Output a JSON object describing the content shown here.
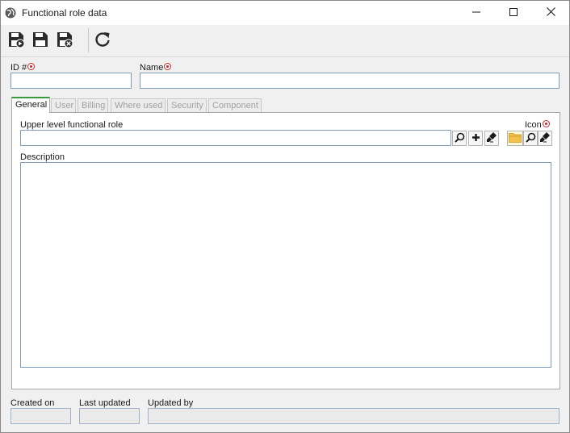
{
  "window": {
    "title": "Functional role data",
    "icons": {
      "app": "globe-icon",
      "minimize": "minimize-icon",
      "maximize": "maximize-icon",
      "close": "close-icon"
    }
  },
  "toolbar": {
    "buttons": [
      {
        "name": "save-and-new-button",
        "icon": "save-new-icon"
      },
      {
        "name": "save-button",
        "icon": "save-icon"
      },
      {
        "name": "save-and-close-button",
        "icon": "save-close-icon"
      },
      {
        "name": "refresh-button",
        "icon": "refresh-icon"
      }
    ]
  },
  "form": {
    "id_label": "ID #",
    "id_value": "",
    "name_label": "Name",
    "name_value": ""
  },
  "tabs": [
    {
      "label": "General",
      "active": true
    },
    {
      "label": "User",
      "active": false
    },
    {
      "label": "Billing",
      "active": false
    },
    {
      "label": "Where used",
      "active": false
    },
    {
      "label": "Security",
      "active": false
    },
    {
      "label": "Component",
      "active": false
    }
  ],
  "general": {
    "upper_level_label": "Upper level functional role",
    "upper_level_value": "",
    "icon_label": "Icon",
    "description_label": "Description",
    "description_value": ""
  },
  "footer": {
    "created_on_label": "Created on",
    "created_on_value": "",
    "last_updated_label": "Last updated",
    "last_updated_value": "",
    "updated_by_label": "Updated by",
    "updated_by_value": ""
  },
  "colors": {
    "required": "#c62828",
    "active_tab_accent": "#3a9a3a",
    "input_border": "#7f9db9",
    "folder": "#f2c14e"
  }
}
